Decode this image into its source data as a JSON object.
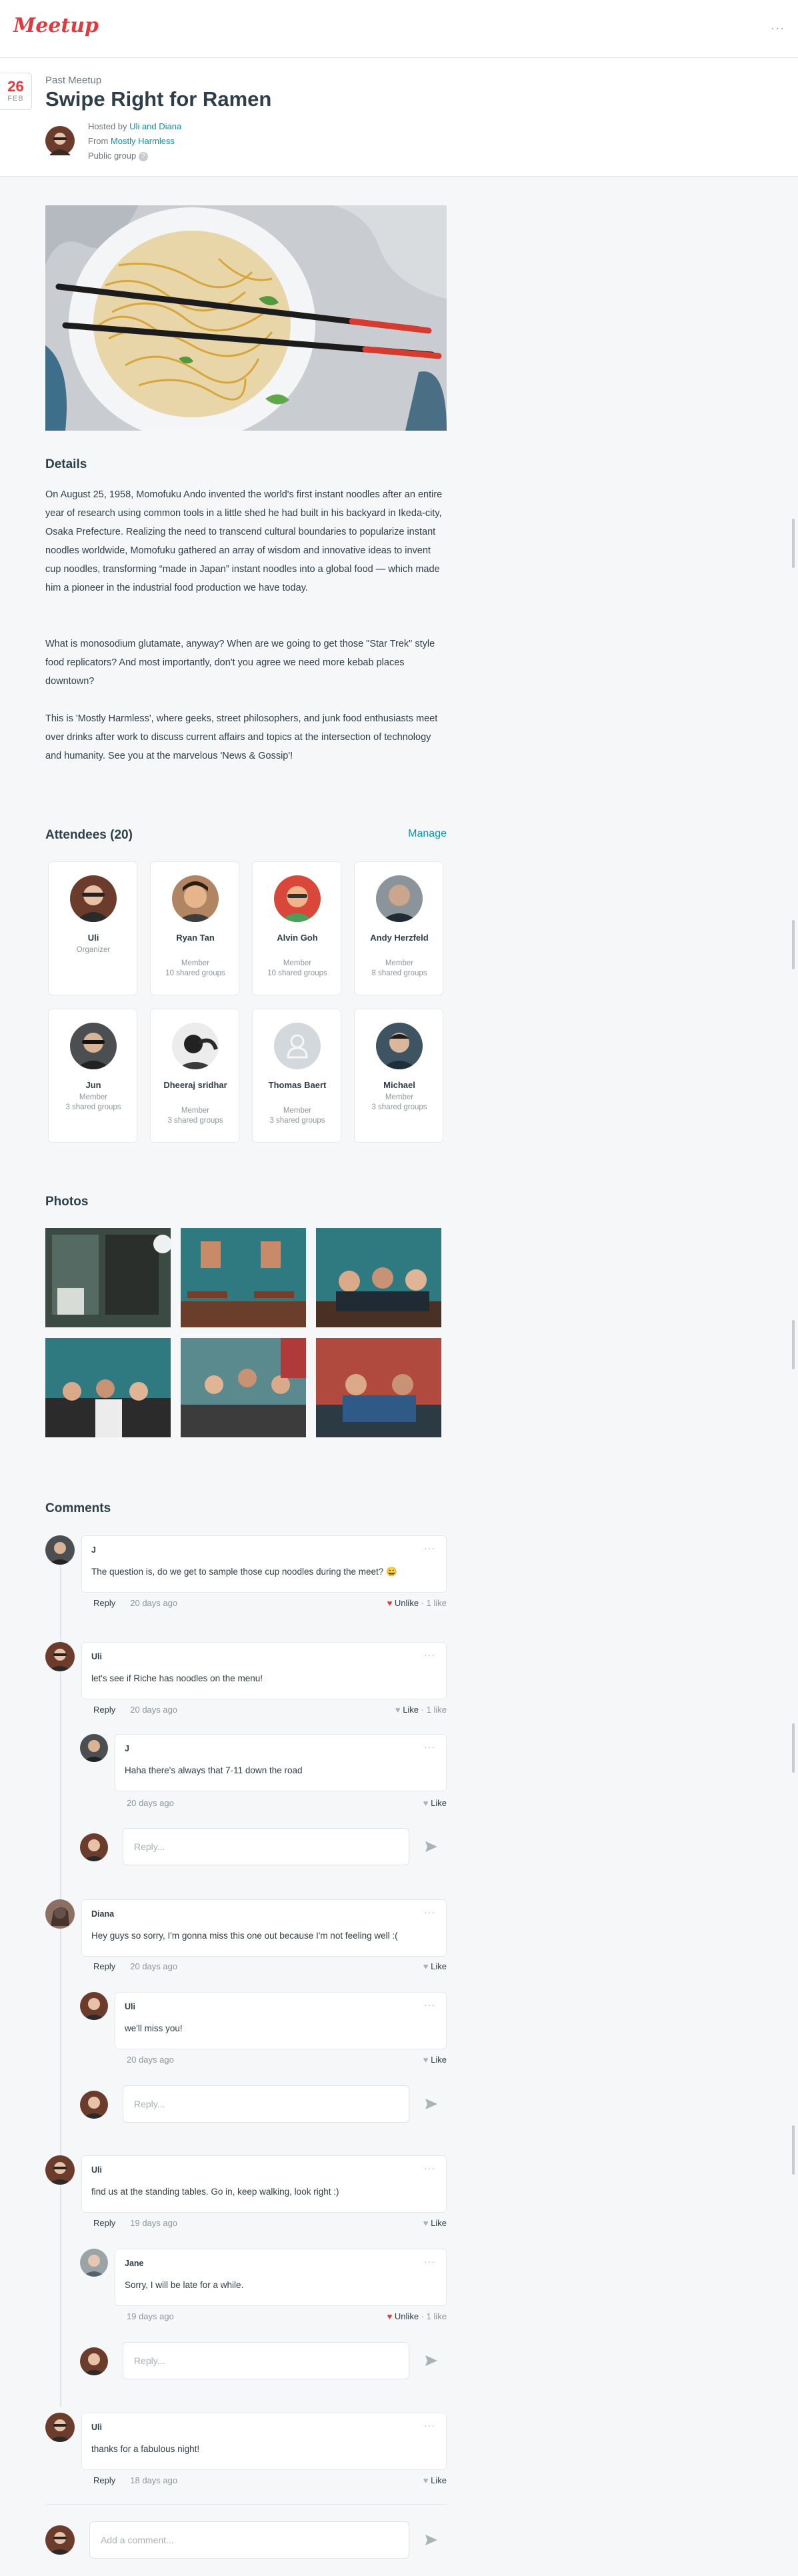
{
  "brand": {
    "logo_text": "Meetup",
    "accent": "#e0393e",
    "link": "#0098ab"
  },
  "header": {
    "more_icon": "···"
  },
  "event": {
    "date_day": "26",
    "date_month": "FEB",
    "past_label": "Past Meetup",
    "title": "Swipe Right for Ramen",
    "hosted_prefix": "Hosted by",
    "hosts": "Uli and Diana",
    "from_prefix": "From",
    "group": "Mostly Harmless",
    "visibility": "Public group",
    "info_icon": "?"
  },
  "details": {
    "heading": "Details",
    "p1": "On August 25, 1958, Momofuku Ando invented the world's first instant noodles after an entire year of research using common tools in a little shed he had built in his backyard in Ikeda-city, Osaka Prefecture. Realizing the need to transcend cultural boundaries to popularize instant noodles worldwide, Momofuku gathered an array of wisdom and innovative ideas to invent cup noodles, transforming “made in Japan” instant noodles into a global food — which made him a pioneer in the industrial food production we have today.",
    "p2": "What is monosodium glutamate, anyway? When are we going to get those \"Star Trek\" style food replicators? And most importantly, don't you agree we need more kebab places downtown?",
    "p3": "This is 'Mostly Harmless', where geeks, street philosophers, and junk food enthusiasts meet over drinks after work to discuss current affairs and topics at the intersection of technology and humanity. See you at the marvelous 'News & Gossip'!"
  },
  "attendees": {
    "heading": "Attendees (20)",
    "manage": "Manage",
    "list": [
      {
        "name": "Uli",
        "role": "Organizer",
        "shared": ""
      },
      {
        "name": "Ryan Tan",
        "role": "Member",
        "shared": "10 shared groups"
      },
      {
        "name": "Alvin Goh",
        "role": "Member",
        "shared": "10 shared groups"
      },
      {
        "name": "Andy Herzfeld",
        "role": "Member",
        "shared": "8 shared groups"
      },
      {
        "name": "Jun",
        "role": "Member",
        "shared": "3 shared groups"
      },
      {
        "name": "Dheeraj sridhar",
        "role": "Member",
        "shared": "3 shared groups"
      },
      {
        "name": "Thomas Baert",
        "role": "Member",
        "shared": "3 shared groups"
      },
      {
        "name": "Michael",
        "role": "Member",
        "shared": "3 shared groups"
      }
    ]
  },
  "photos": {
    "heading": "Photos"
  },
  "comments": {
    "heading": "Comments",
    "reply": "Reply",
    "more": "···",
    "reply_placeholder": "Reply...",
    "add_placeholder": "Add a comment...",
    "items": [
      {
        "author": "J",
        "text": "The question is, do we get to sample those cup noodles during the meet? 😀",
        "time": "20 days ago",
        "like_label": "Unlike",
        "likes": "1 like"
      },
      {
        "author": "Uli",
        "text": "let's see if Riche has noodles on the menu!",
        "time": "20 days ago",
        "like_label": "Like",
        "likes": "1 like"
      },
      {
        "author": "J",
        "text": "Haha there's always that 7-11 down the road",
        "time": "20 days ago",
        "like_label": "Like",
        "likes": ""
      },
      {
        "author": "Diana",
        "text": "Hey guys so sorry, I'm gonna miss this one out because I'm not feeling well :(",
        "time": "20 days ago",
        "like_label": "Like",
        "likes": ""
      },
      {
        "author": "Uli",
        "text": "we'll miss you!",
        "time": "20 days ago",
        "like_label": "Like",
        "likes": ""
      },
      {
        "author": "Uli",
        "text": "find us at the standing tables. Go in, keep walking, look right :)",
        "time": "19 days ago",
        "like_label": "Like",
        "likes": ""
      },
      {
        "author": "Jane",
        "text": "Sorry, I will be late for a while.",
        "time": "19 days ago",
        "like_label": "Unlike",
        "likes": "1 like"
      },
      {
        "author": "Uli",
        "text": "thanks for a fabulous night!",
        "time": "18 days ago",
        "like_label": "Like",
        "likes": ""
      }
    ]
  }
}
